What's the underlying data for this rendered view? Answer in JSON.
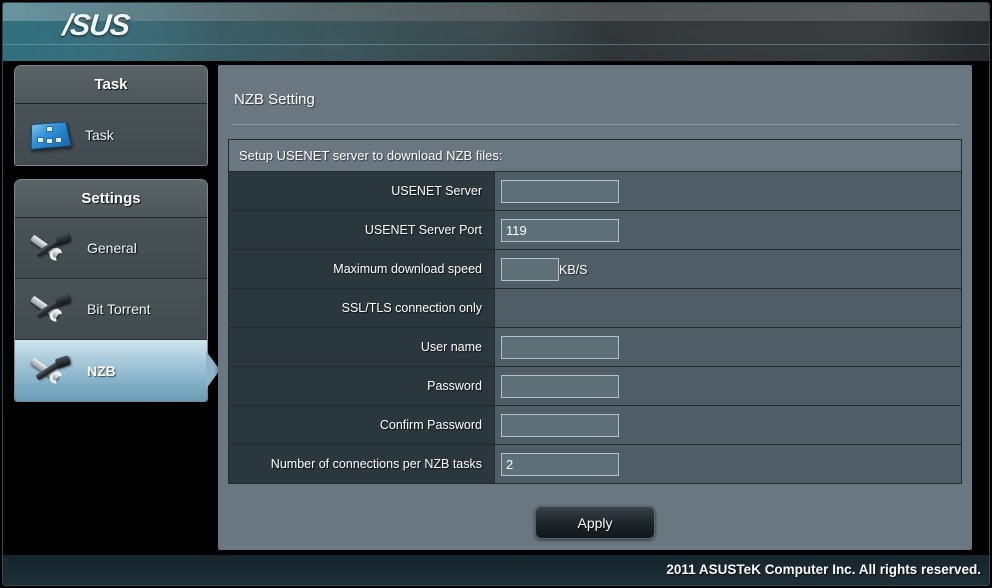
{
  "header": {
    "logo": "/SUS"
  },
  "sidebar": {
    "groups": [
      {
        "title": "Task",
        "items": [
          {
            "label": "Task",
            "icon": "task-grid-icon",
            "active": false
          }
        ]
      },
      {
        "title": "Settings",
        "items": [
          {
            "label": "General",
            "icon": "tools-icon",
            "active": false
          },
          {
            "label": "Bit Torrent",
            "icon": "tools-icon",
            "active": false
          },
          {
            "label": "NZB",
            "icon": "tools-icon",
            "active": true
          }
        ]
      }
    ]
  },
  "content": {
    "title": "NZB Setting",
    "table_header": "Setup USENET server to download NZB files:",
    "rows": [
      {
        "label": "USENET Server",
        "value": "",
        "field": "text",
        "width": "wide",
        "unit": ""
      },
      {
        "label": "USENET Server Port",
        "value": "119",
        "field": "text",
        "width": "wide",
        "unit": ""
      },
      {
        "label": "Maximum download speed",
        "value": "",
        "field": "text",
        "width": "narrow",
        "unit": "KB/S"
      },
      {
        "label": "SSL/TLS connection only",
        "value": "",
        "field": "none",
        "width": "",
        "unit": ""
      },
      {
        "label": "User name",
        "value": "",
        "field": "text",
        "width": "wide",
        "unit": ""
      },
      {
        "label": "Password",
        "value": "",
        "field": "text",
        "width": "wide",
        "unit": ""
      },
      {
        "label": "Confirm Password",
        "value": "",
        "field": "text",
        "width": "wide",
        "unit": ""
      },
      {
        "label": "Number of connections per NZB tasks",
        "value": "2",
        "field": "text",
        "width": "wide",
        "unit": ""
      }
    ],
    "apply_label": "Apply"
  },
  "footer": {
    "copyright": "2011 ASUSTeK Computer Inc. All rights reserved."
  },
  "colors": {
    "panel": "#6b7780",
    "label_cell": "#2a373d",
    "field_cell": "#4f5e66",
    "input": "#5d7077",
    "active_item_top": "#cfe3ee",
    "active_item_bottom": "#6c9db6",
    "footer": "#1d2f38"
  }
}
